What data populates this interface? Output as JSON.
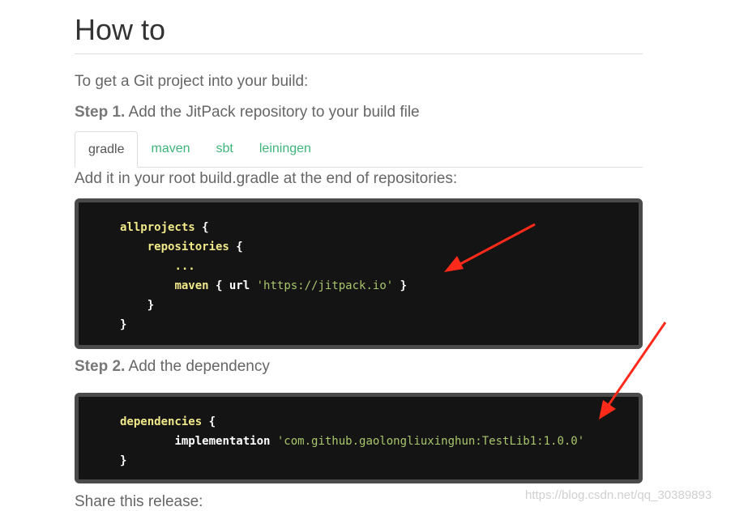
{
  "page": {
    "title": "How to",
    "intro": "To get a Git project into your build:"
  },
  "step1": {
    "label": "Step 1.",
    "text": " Add the JitPack repository to your build file"
  },
  "tabs": [
    {
      "label": "gradle",
      "active": true
    },
    {
      "label": "maven",
      "active": false
    },
    {
      "label": "sbt",
      "active": false
    },
    {
      "label": "leiningen",
      "active": false
    }
  ],
  "tab_description": "Add it in your root build.gradle at the end of repositories:",
  "code_block_1": {
    "lines": [
      {
        "indent": "",
        "kw": "allprojects",
        "rest": " {"
      },
      {
        "indent": "    ",
        "kw": "repositories",
        "rest": " {"
      },
      {
        "indent": "        ",
        "kw": "...",
        "rest": ""
      },
      {
        "indent": "        ",
        "kw": "maven",
        "rest": " { url ",
        "str": "'https://jitpack.io'",
        "tail": " }"
      },
      {
        "indent": "    ",
        "kw": "",
        "rest": "}"
      },
      {
        "indent": "",
        "kw": "",
        "rest": "}"
      }
    ]
  },
  "step2": {
    "label": "Step 2.",
    "text": " Add the dependency"
  },
  "code_block_2": {
    "lines": [
      {
        "indent": "",
        "kw": "dependencies",
        "rest": " {"
      },
      {
        "indent": "        ",
        "kw": "",
        "rest": "implementation ",
        "str": "'com.github.gaolongliuxinghun:TestLib1:1.0.0'"
      },
      {
        "indent": "",
        "kw": "",
        "rest": "}"
      }
    ]
  },
  "share": "Share this release:",
  "watermark": "https://blog.csdn.net/qq_30389893",
  "colors": {
    "accent": "#3fb47a",
    "arrow": "#ff2a1a",
    "code_bg": "#141414",
    "code_keyword": "#f1e88a",
    "code_string": "#a8c66b"
  }
}
